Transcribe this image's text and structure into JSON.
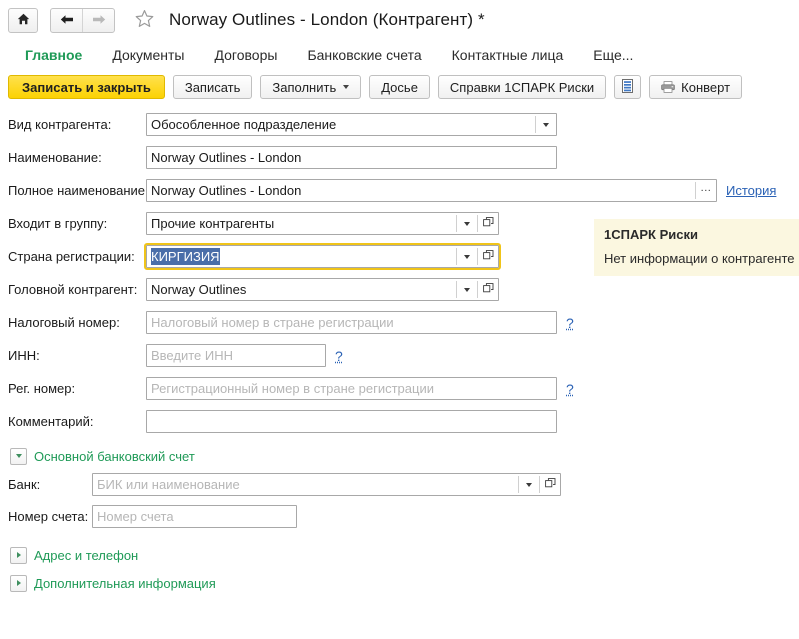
{
  "titlebar": {
    "home_icon": "home-icon",
    "back_icon": "arrow-left-icon",
    "forward_icon": "arrow-right-icon",
    "favorite_icon": "star-outline-icon",
    "title": "Norway Outlines - London (Контрагент) *"
  },
  "tabs": [
    {
      "label": "Главное",
      "active": true
    },
    {
      "label": "Документы",
      "active": false
    },
    {
      "label": "Договоры",
      "active": false
    },
    {
      "label": "Банковские счета",
      "active": false
    },
    {
      "label": "Контактные лица",
      "active": false
    },
    {
      "label": "Еще...",
      "active": false
    }
  ],
  "toolbar": {
    "save_and_close": "Записать и закрыть",
    "save": "Записать",
    "fill": "Заполнить",
    "dossier": "Досье",
    "spark_reports": "Справки 1СПАРК Риски",
    "report_icon": "report-list-icon",
    "envelope": "Конверт",
    "envelope_icon": "printer-icon"
  },
  "form": {
    "fields": [
      {
        "label": "Вид контрагента:",
        "value": "Обособленное подразделение",
        "placeholder": "",
        "controls": [
          "dropdown"
        ]
      },
      {
        "label": "Наименование:",
        "value": "Norway Outlines - London",
        "placeholder": "",
        "controls": []
      },
      {
        "label": "Полное наименование:",
        "value": "Norway Outlines - London",
        "placeholder": "",
        "controls": [
          "ellipsis"
        ],
        "link": "История"
      },
      {
        "label": "Входит в группу:",
        "value": "Прочие контрагенты",
        "placeholder": "",
        "controls": [
          "dropdown",
          "select"
        ]
      },
      {
        "label": "Страна регистрации:",
        "value": "КИРГИЗИЯ",
        "placeholder": "",
        "controls": [
          "dropdown",
          "select"
        ],
        "focused": true,
        "selected": true
      },
      {
        "label": "Головной контрагент:",
        "value": "Norway Outlines",
        "placeholder": "",
        "controls": [
          "dropdown",
          "select"
        ]
      },
      {
        "label": "Налоговый номер:",
        "value": "",
        "placeholder": "Налоговый номер в стране регистрации",
        "controls": [],
        "help": "?"
      },
      {
        "label": "ИНН:",
        "value": "",
        "placeholder": "Введите ИНН",
        "controls": [],
        "help": "?"
      },
      {
        "label": "Рег. номер:",
        "value": "",
        "placeholder": "Регистрационный номер в стране регистрации",
        "controls": [],
        "help": "?"
      },
      {
        "label": "Комментарий:",
        "value": "",
        "placeholder": "",
        "controls": []
      }
    ],
    "bank_group": {
      "label": "Основной банковский счет",
      "expanded": true,
      "bank_label": "Банк:",
      "bank_placeholder": "БИК или наименование",
      "account_label": "Номер счета:",
      "account_placeholder": "Номер счета"
    },
    "collapsed_groups": [
      {
        "label": "Адрес и телефон"
      },
      {
        "label": "Дополнительная информация"
      }
    ]
  },
  "spark": {
    "title": "1СПАРК Риски",
    "message": "Нет информации о контрагенте"
  },
  "colors": {
    "accent_green": "#1f9a57",
    "primary_button": "#fcd203",
    "focus_outline": "#f0c419",
    "selection": "#4a6ea9",
    "link": "#2b62b5",
    "panel_bg": "#fbf7e0"
  }
}
